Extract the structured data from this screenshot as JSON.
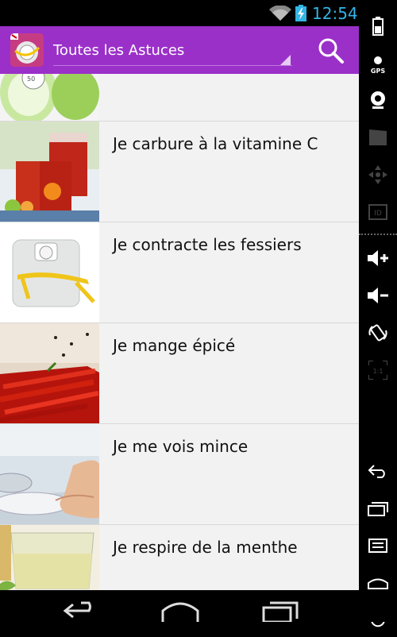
{
  "status_bar": {
    "time": "12:54",
    "time_color": "#33b5e5",
    "icons": [
      "wifi-icon",
      "battery-charging-icon"
    ]
  },
  "action_bar": {
    "background": "#9b30c9",
    "spinner_label": "Toutes les Astuces",
    "icons": [
      "app-logo-icon",
      "search-icon"
    ]
  },
  "list": {
    "items": [
      {
        "label": "",
        "thumb": "scale-and-apples"
      },
      {
        "label": "Je carbure à la vitamine C",
        "thumb": "fruit-punch-glasses"
      },
      {
        "label": "Je contracte les fessiers",
        "thumb": "scale-with-tape-measure"
      },
      {
        "label": "Je mange épicé",
        "thumb": "red-chili-peppers"
      },
      {
        "label": "Je me vois mince",
        "thumb": "feet-on-scale"
      },
      {
        "label": "Je respire de la menthe",
        "thumb": "mint-tea-glass"
      }
    ]
  },
  "side_panel": {
    "gps_label": "GPS",
    "id_label": "ID",
    "ratio_label": "1:1",
    "icons": [
      "battery-icon",
      "gps-icon",
      "webcam-icon",
      "clapper-icon",
      "dpad-icon",
      "id-icon",
      "volume-up-icon",
      "volume-down-icon",
      "rotate-icon",
      "ratio-icon",
      "back-icon",
      "recent-apps-icon",
      "menu-icon",
      "home-icon",
      "power-icon"
    ]
  },
  "nav_bar": {
    "icons": [
      "back-icon",
      "home-icon",
      "recent-apps-icon",
      "power-icon"
    ]
  }
}
